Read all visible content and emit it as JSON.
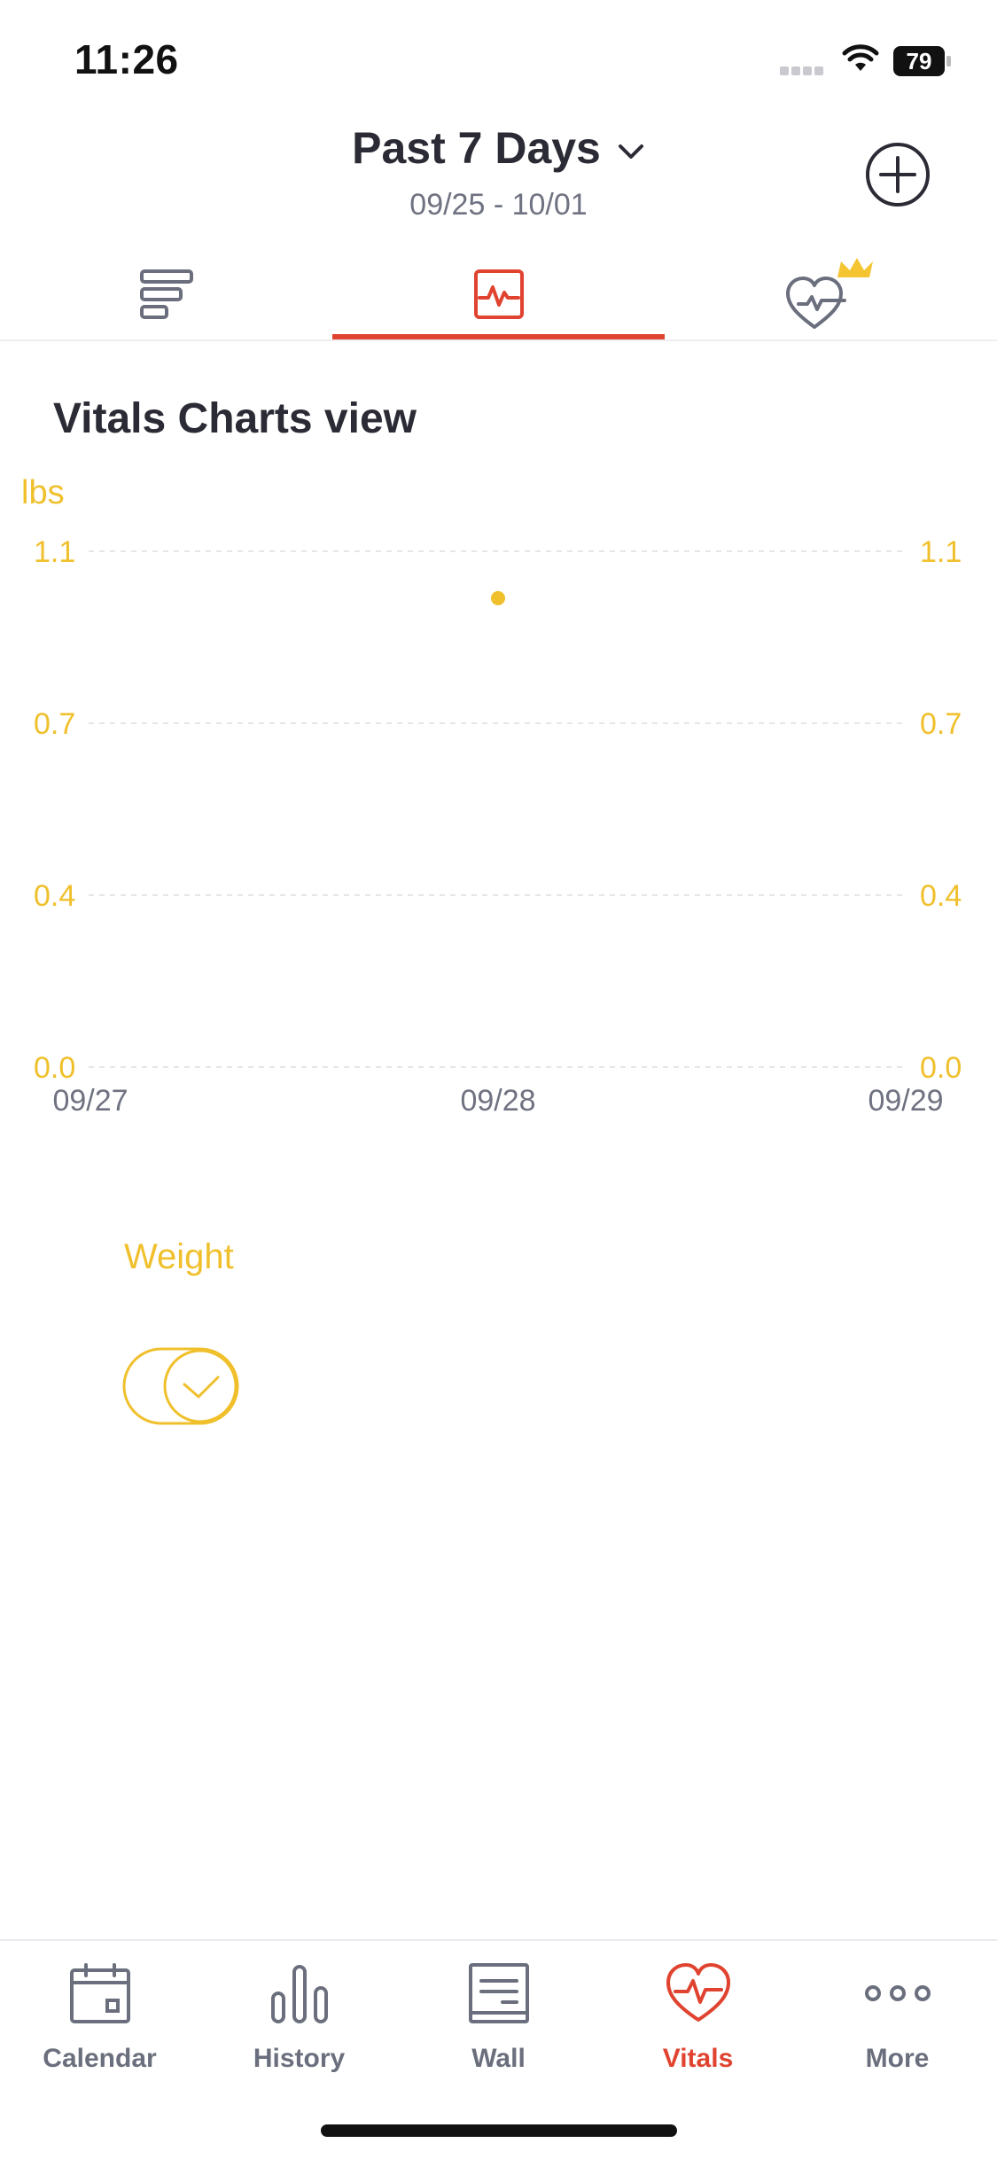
{
  "status_bar": {
    "time": "11:26",
    "battery": "79"
  },
  "header": {
    "period_title": "Past 7 Days",
    "date_range": "09/25 - 10/01"
  },
  "tabs": [
    {
      "name": "list",
      "icon": "list-bars-icon",
      "active": false
    },
    {
      "name": "chart",
      "icon": "chart-icon",
      "active": true
    },
    {
      "name": "vitals-premium",
      "icon": "heart-crown-icon",
      "active": false
    }
  ],
  "section": {
    "title": "Vitals Charts view"
  },
  "chart_data": {
    "type": "scatter",
    "unit_label": "lbs",
    "y_ticks": [
      "1.1",
      "0.7",
      "0.4",
      "0.0"
    ],
    "y_range": [
      0,
      1.1
    ],
    "x_ticks": [
      "09/27",
      "09/28",
      "09/29"
    ],
    "series": [
      {
        "name": "Weight",
        "color": "#f0c02c",
        "points": [
          {
            "x": "09/28",
            "y": 1.0
          }
        ]
      }
    ],
    "grid": true,
    "grid_style": "dashed"
  },
  "legend": {
    "label": "Weight",
    "enabled": true,
    "color": "#f0c02c"
  },
  "bottom_nav": [
    {
      "label": "Calendar",
      "icon": "calendar-icon",
      "active": false
    },
    {
      "label": "History",
      "icon": "bar-chart-icon",
      "active": false
    },
    {
      "label": "Wall",
      "icon": "wall-icon",
      "active": false
    },
    {
      "label": "Vitals",
      "icon": "heart-pulse-icon",
      "active": true
    },
    {
      "label": "More",
      "icon": "more-dots-icon",
      "active": false
    }
  ],
  "colors": {
    "accent": "#e0432f",
    "chart": "#f0c02c",
    "text": "#2b2b35",
    "muted": "#6b6f7d"
  }
}
